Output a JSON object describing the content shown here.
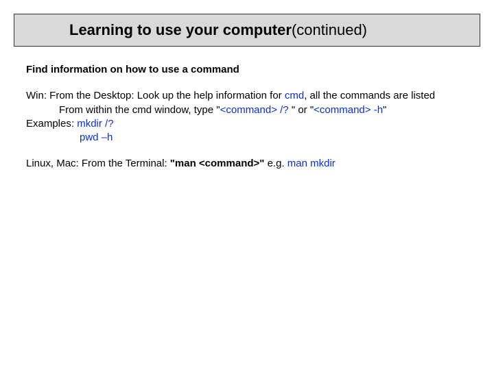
{
  "title": {
    "bold": "Learning to use your computer ",
    "regular": "(continued)"
  },
  "heading": "Find information on how to use a command",
  "win": {
    "line1_prefix": "Win: From the Desktop: Look up the help information for ",
    "cmd": "cmd",
    "line1_suffix": ", all the commands are listed",
    "line2_prefix": "From within the cmd window, type \"",
    "cmd_q": "<command> /?",
    "line2_mid": " \" or \"",
    "cmd_h": "<command> -h",
    "line2_suffix": "\"",
    "examples_label": "Examples: ",
    "ex1": "mkdir /?",
    "ex2": "pwd –h"
  },
  "linux": {
    "prefix": "Linux, Mac:  From the Terminal: ",
    "man_b": "\"man <command>\" ",
    "mid": " e.g. ",
    "man_ex": "man mkdir"
  }
}
